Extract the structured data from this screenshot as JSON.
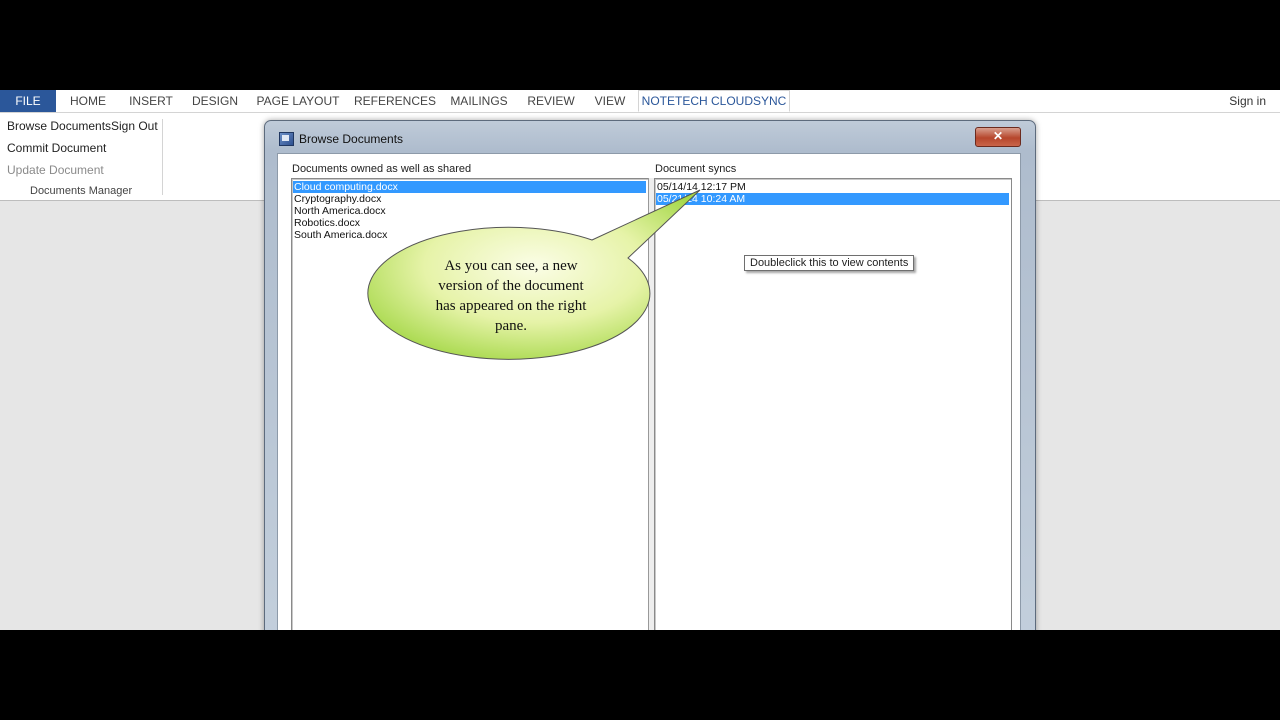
{
  "ribbon": {
    "tabs": [
      {
        "label": "FILE"
      },
      {
        "label": "HOME"
      },
      {
        "label": "INSERT"
      },
      {
        "label": "DESIGN"
      },
      {
        "label": "PAGE LAYOUT"
      },
      {
        "label": "REFERENCES"
      },
      {
        "label": "MAILINGS"
      },
      {
        "label": "REVIEW"
      },
      {
        "label": "VIEW"
      },
      {
        "label": "NOTETECH CLOUDSYNC"
      }
    ],
    "active_tab": "NOTETECH CLOUDSYNC",
    "sign_in": "Sign in",
    "buttons": {
      "browse": "Browse Documents",
      "sign_out": "Sign Out",
      "commit": "Commit Document",
      "update": "Update Document"
    },
    "group_label": "Documents Manager"
  },
  "dialog": {
    "title": "Browse Documents",
    "close_glyph": "✕",
    "left_pane": {
      "label": "Documents owned as well as shared",
      "items": [
        {
          "name": "Cloud computing.docx",
          "selected": true
        },
        {
          "name": "Cryptography.docx",
          "selected": false
        },
        {
          "name": "North America.docx",
          "selected": false
        },
        {
          "name": "Robotics.docx",
          "selected": false
        },
        {
          "name": "South America.docx",
          "selected": false
        }
      ]
    },
    "right_pane": {
      "label": "Document syncs",
      "items": [
        {
          "name": "05/14/14 12:17 PM",
          "selected": false
        },
        {
          "name": "05/21/14 10:24 AM",
          "selected": true
        }
      ]
    },
    "tooltip": "Doubleclick this to view contents"
  },
  "callout": {
    "lines": [
      "As you can see, a new",
      "version of the document",
      "has appeared on the right",
      "pane."
    ]
  },
  "colors": {
    "file_tab": "#2b579a",
    "selection": "#3399ff",
    "callout_fill_center": "#fbfde6",
    "callout_fill_edge": "#a6d84a"
  }
}
